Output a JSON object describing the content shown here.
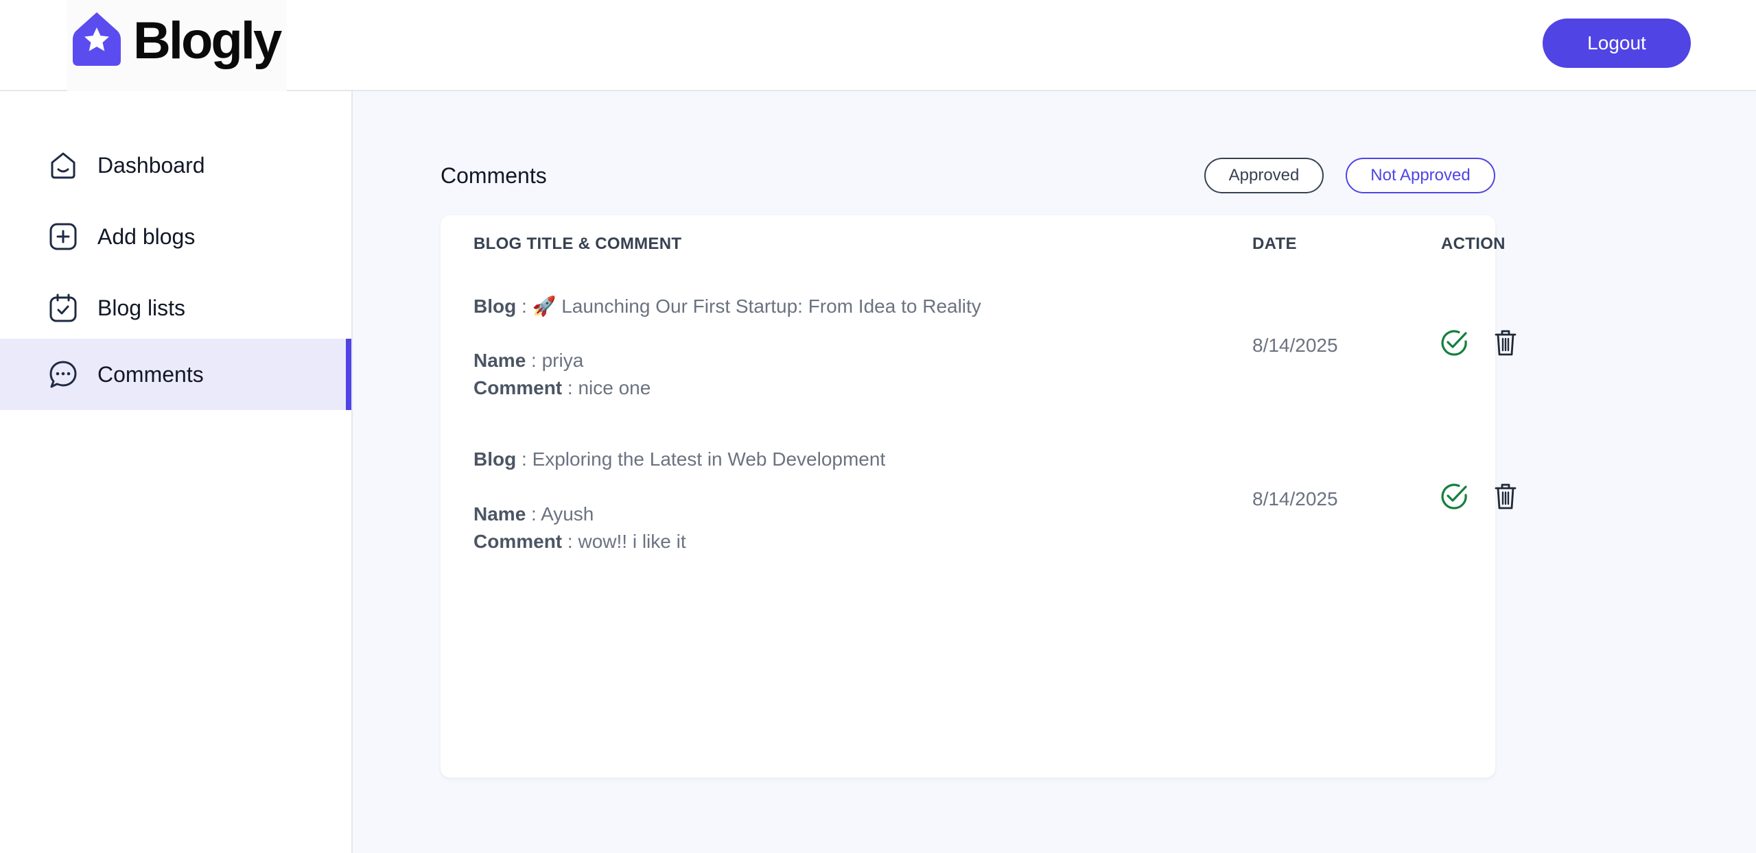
{
  "app": {
    "name": "Blogly"
  },
  "header": {
    "logout_label": "Logout"
  },
  "sidebar": {
    "items": [
      {
        "label": "Dashboard",
        "icon": "home-icon"
      },
      {
        "label": "Add blogs",
        "icon": "add-square-icon"
      },
      {
        "label": "Blog lists",
        "icon": "calendar-check-icon"
      },
      {
        "label": "Comments",
        "icon": "chat-bubble-icon",
        "active": true
      }
    ]
  },
  "main": {
    "title": "Comments",
    "filters": {
      "approved": "Approved",
      "not_approved": "Not Approved"
    },
    "table": {
      "headers": {
        "title_comment": "BLOG TITLE & COMMENT",
        "date": "DATE",
        "action": "ACTION"
      },
      "field_labels": {
        "blog": "Blog",
        "name": "Name",
        "comment": "Comment"
      },
      "rows": [
        {
          "blog": "🚀 Launching Our First Startup: From Idea to Reality",
          "name": "priya",
          "comment": "nice one",
          "date": "8/14/2025"
        },
        {
          "blog": "Exploring the Latest in Web Development",
          "name": "Ayush",
          "comment": "wow!! i like it",
          "date": "8/14/2025"
        }
      ]
    }
  },
  "colors": {
    "accent": "#5044e5",
    "approve_green": "#15803d",
    "active_nav_bg": "#ebeafa",
    "main_bg": "#f6f8fd"
  }
}
